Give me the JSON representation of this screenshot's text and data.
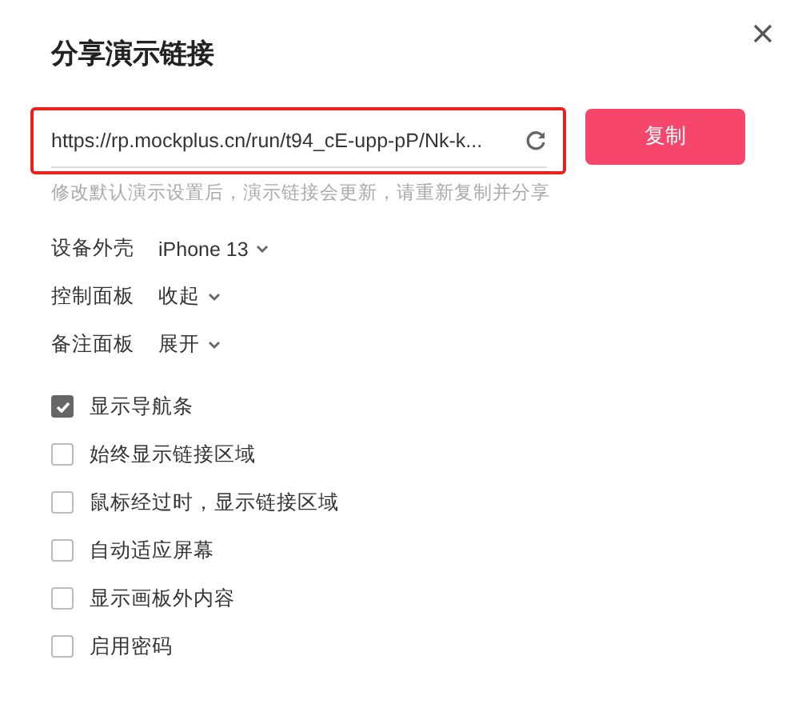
{
  "dialog": {
    "title": "分享演示链接"
  },
  "link": {
    "value": "https://rp.mockplus.cn/run/t94_cE-upp-pP/Nk-k...",
    "highlighted": true
  },
  "copy_button": "复制",
  "hint": "修改默认演示设置后，演示链接会更新，请重新复制并分享",
  "settings": [
    {
      "label": "设备外壳",
      "value": "iPhone 13"
    },
    {
      "label": "控制面板",
      "value": "收起"
    },
    {
      "label": "备注面板",
      "value": "展开"
    }
  ],
  "options": [
    {
      "label": "显示导航条",
      "checked": true
    },
    {
      "label": "始终显示链接区域",
      "checked": false
    },
    {
      "label": "鼠标经过时，显示链接区域",
      "checked": false
    },
    {
      "label": "自动适应屏幕",
      "checked": false
    },
    {
      "label": "显示画板外内容",
      "checked": false
    },
    {
      "label": "启用密码",
      "checked": false
    }
  ]
}
